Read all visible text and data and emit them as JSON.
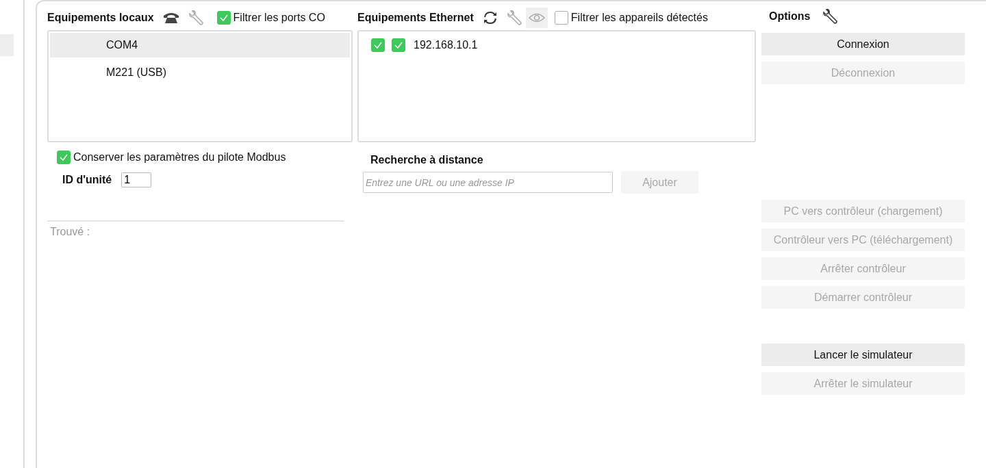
{
  "local": {
    "title": "Equipements locaux",
    "filter": {
      "label": "Filtrer les ports CO",
      "checked": true
    },
    "devices": [
      {
        "label": "COM4",
        "selected": true
      },
      {
        "label": "M221 (USB)",
        "selected": false
      }
    ],
    "keep_modbus": {
      "label": "Conserver les paramètres du pilote Modbus",
      "checked": true
    },
    "unit_id": {
      "label": "ID d'unité",
      "value": "1"
    },
    "found": "Trouvé :"
  },
  "ethernet": {
    "title": "Equipements Ethernet",
    "filter": {
      "label": "Filtrer les appareils détectés",
      "checked": false
    },
    "devices": [
      {
        "label": "192.168.10.1",
        "checked_a": true,
        "checked_b": true
      }
    ],
    "remote": {
      "title": "Recherche à distance",
      "placeholder": "Entrez une URL ou une adresse IP",
      "button": {
        "label": "Ajouter",
        "disabled": true
      }
    }
  },
  "options": {
    "title": "Options",
    "groups": [
      [
        {
          "label": "Connexion",
          "disabled": false
        },
        {
          "label": "Déconnexion",
          "disabled": true
        }
      ],
      [
        {
          "label": "PC vers contrôleur (chargement)",
          "disabled": true
        },
        {
          "label": "Contrôleur vers PC (téléchargement)",
          "disabled": true
        },
        {
          "label": "Arrêter contrôleur",
          "disabled": true
        },
        {
          "label": "Démarrer contrôleur",
          "disabled": true
        }
      ],
      [
        {
          "label": "Lancer le simulateur",
          "disabled": false
        },
        {
          "label": "Arrêter le simulateur",
          "disabled": true
        }
      ]
    ]
  }
}
